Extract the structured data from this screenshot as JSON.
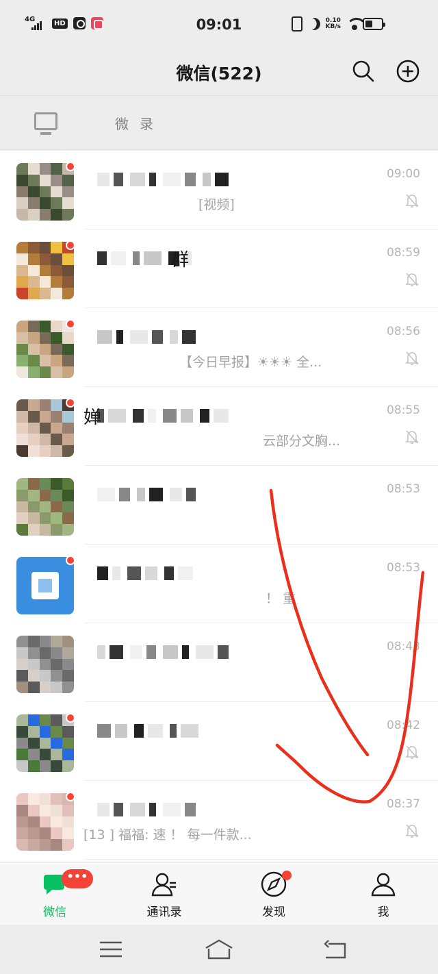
{
  "status_bar": {
    "network": "4G",
    "hd": "HD",
    "time": "09:01",
    "speed_top": "0.10",
    "speed_bottom": "KB/s"
  },
  "header": {
    "title": "微信(522)"
  },
  "pc_banner": {
    "text": "微    录"
  },
  "chats": [
    {
      "name": "",
      "preview": "[视频]",
      "time": "09:00",
      "muted": true,
      "unread_dot": true
    },
    {
      "name": "群",
      "preview": "",
      "time": "08:59",
      "muted": true,
      "unread_dot": true
    },
    {
      "name": "",
      "preview": "【今日早报】☀☀☀ 全...",
      "time": "08:56",
      "muted": true,
      "unread_dot": true
    },
    {
      "name": "婵",
      "preview": "云部分文胸...",
      "time": "08:55",
      "muted": true,
      "unread_dot": true
    },
    {
      "name": "",
      "preview": "",
      "time": "08:53",
      "muted": false,
      "unread_dot": false
    },
    {
      "name": "",
      "preview": "！ 重",
      "time": "08:53",
      "muted": false,
      "unread_dot": true
    },
    {
      "name": "",
      "preview": "",
      "time": "08:43",
      "muted": false,
      "unread_dot": false
    },
    {
      "name": "",
      "preview": "",
      "time": "08:42",
      "muted": true,
      "unread_dot": true
    },
    {
      "name": "",
      "preview": "[13   ] 福福: 速        ！ 每一件款...",
      "time": "08:37",
      "muted": true,
      "unread_dot": true
    }
  ],
  "tabs": [
    {
      "label": "微信",
      "badge": "•••",
      "icon": "chat-icon"
    },
    {
      "label": "通讯录",
      "icon": "contacts-icon"
    },
    {
      "label": "发现",
      "icon": "compass-icon"
    },
    {
      "label": "我",
      "icon": "profile-icon"
    }
  ],
  "colors": {
    "accent": "#07c160",
    "badge": "#f44336",
    "annotation": "#e8301c"
  }
}
